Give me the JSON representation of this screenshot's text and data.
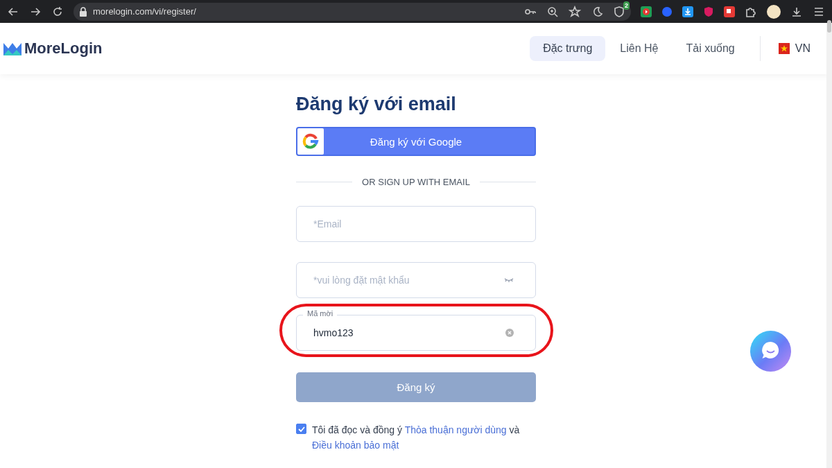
{
  "browser": {
    "url": "morelogin.com/vi/register/",
    "badge": "2"
  },
  "header": {
    "logo": "MoreLogin",
    "nav": [
      {
        "label": "Đặc trưng",
        "selected": true
      },
      {
        "label": "Liên Hệ",
        "selected": false
      },
      {
        "label": "Tải xuống",
        "selected": false
      }
    ],
    "language": "VN"
  },
  "form": {
    "title": "Đăng ký với email",
    "google_button": "Đăng ký với Google",
    "divider": "OR SIGN UP WITH EMAIL",
    "fields": [
      {
        "kind": "email",
        "placeholder": "*Email"
      },
      {
        "kind": "password",
        "placeholder": "*vui lòng đặt mật khẩu"
      },
      {
        "kind": "invite",
        "label": "Mã mời",
        "value": "hvmo123",
        "highlighted": true
      }
    ],
    "submit": {
      "label": "Đăng ký",
      "disabled": true
    },
    "agreement": {
      "checked": true,
      "text": "Tôi đã đọc và đồng ý",
      "link": "Thỏa thuận người dùng",
      "conjunction": "và",
      "link2": "Điều khoản bảo mật"
    }
  }
}
